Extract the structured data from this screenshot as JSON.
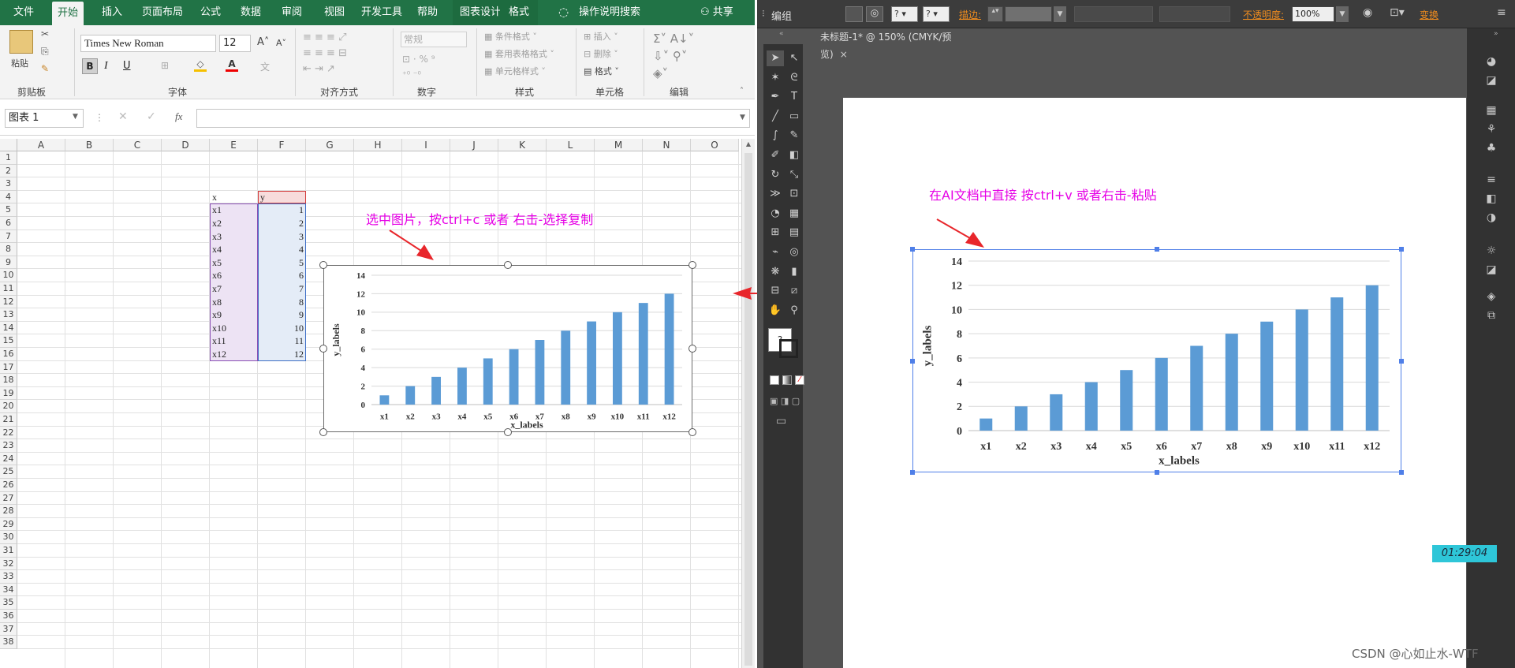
{
  "excel": {
    "tabs": [
      "文件",
      "开始",
      "插入",
      "页面布局",
      "公式",
      "数据",
      "审阅",
      "视图",
      "开发工具",
      "帮助",
      "图表设计",
      "格式"
    ],
    "active_tab": "开始",
    "tell_me": "操作说明搜索",
    "share": "共享",
    "clipboard": {
      "paste": "粘贴",
      "label": "剪贴板"
    },
    "font": {
      "name": "Times New Roman",
      "size": "12",
      "label": "字体",
      "bold": "B",
      "italic": "I",
      "underline": "U"
    },
    "alignment": {
      "label": "对齐方式"
    },
    "number": {
      "format": "常规",
      "label": "数字"
    },
    "styles": {
      "cond": "条件格式",
      "table": "套用表格格式",
      "cell": "单元格样式",
      "label": "样式"
    },
    "cells": {
      "insert": "插入",
      "delete": "删除",
      "format": "格式",
      "label": "单元格"
    },
    "editing": {
      "label": "编辑"
    },
    "name_box": "图表 1",
    "fx": "fx",
    "columns": [
      "A",
      "B",
      "C",
      "D",
      "E",
      "F",
      "G",
      "H",
      "I",
      "J",
      "K",
      "L",
      "M",
      "N",
      "O"
    ],
    "rows": [
      "1",
      "2",
      "3",
      "4",
      "5",
      "6",
      "7",
      "8",
      "9",
      "10",
      "11",
      "12",
      "13",
      "14",
      "15",
      "16",
      "17",
      "18",
      "19",
      "20",
      "21",
      "22",
      "23",
      "24",
      "25",
      "26",
      "27",
      "28",
      "29",
      "30",
      "31",
      "32",
      "33",
      "34",
      "35",
      "36",
      "37",
      "38"
    ],
    "table": {
      "header": [
        "x",
        "y"
      ],
      "rows": [
        [
          "x1",
          "1"
        ],
        [
          "x2",
          "2"
        ],
        [
          "x3",
          "3"
        ],
        [
          "x4",
          "4"
        ],
        [
          "x5",
          "5"
        ],
        [
          "x6",
          "6"
        ],
        [
          "x7",
          "7"
        ],
        [
          "x8",
          "8"
        ],
        [
          "x9",
          "9"
        ],
        [
          "x10",
          "10"
        ],
        [
          "x11",
          "11"
        ],
        [
          "x12",
          "12"
        ]
      ]
    },
    "annotation": "选中图片，按ctrl+c 或者 右击-选择复制"
  },
  "ai": {
    "mode": "编组",
    "stroke_label": "描边:",
    "opacity_label": "不透明度:",
    "opacity_value": "100%",
    "transform": "变换",
    "doc_tab": "未标题-1* @ 150% (CMYK/预览)",
    "annotation": "在AI文档中直接 按ctrl+v 或者右击-粘贴",
    "timer": "01:29:04"
  },
  "watermark": "CSDN @心如止水-WTF",
  "colors": {
    "excel_green": "#217346",
    "bar_blue": "#5b9bd5",
    "annotation": "#e600e6",
    "arrow": "#e8262b"
  },
  "chart_data": {
    "type": "bar",
    "categories": [
      "x1",
      "x2",
      "x3",
      "x4",
      "x5",
      "x6",
      "x7",
      "x8",
      "x9",
      "x10",
      "x11",
      "x12"
    ],
    "values": [
      1,
      2,
      3,
      4,
      5,
      6,
      7,
      8,
      9,
      10,
      11,
      12
    ],
    "xlabel": "x_labels",
    "ylabel": "y_labels",
    "ylim": [
      0,
      14
    ],
    "yticks": [
      0,
      2,
      4,
      6,
      8,
      10,
      12,
      14
    ],
    "grid": true
  }
}
